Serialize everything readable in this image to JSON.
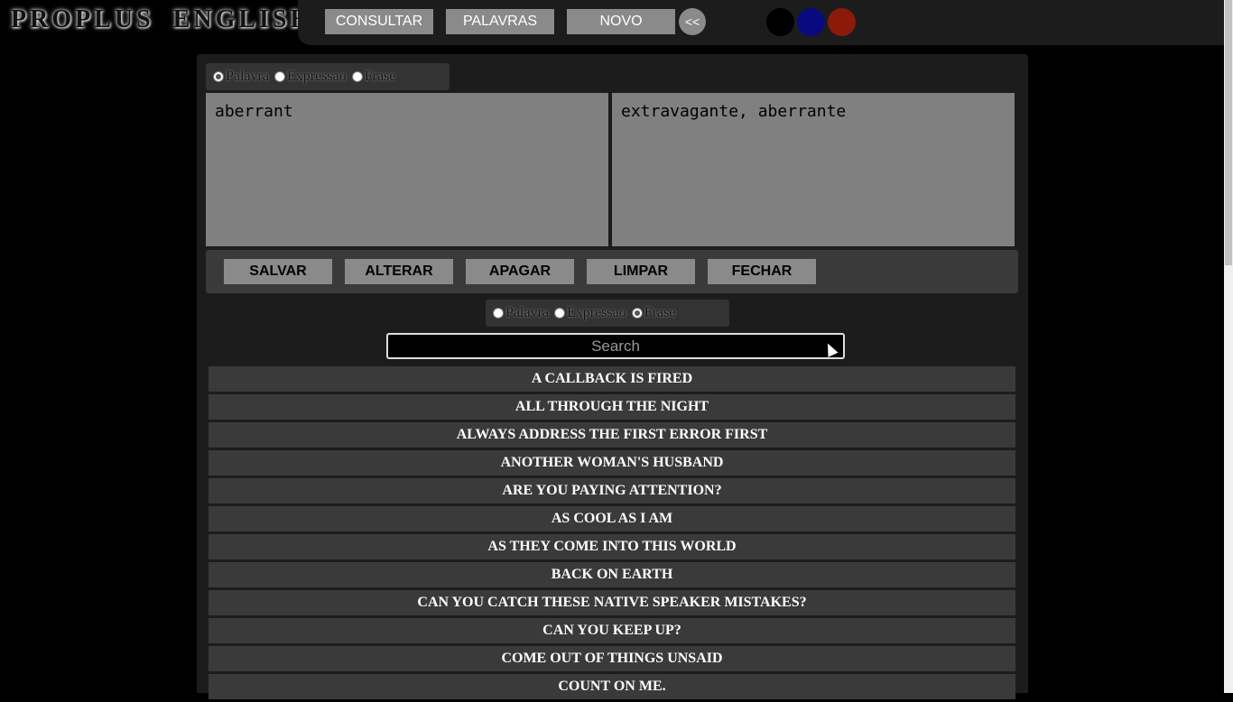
{
  "logo": "PROPLUS ENGLISH",
  "nav": {
    "consultar": "CONSULTAR",
    "palavras": "PALAVRAS",
    "novo": "NOVO",
    "collapse": "<<"
  },
  "theme_colors": [
    "#000000",
    "#0a0a80",
    "#8b1a0a"
  ],
  "entry_type": {
    "options": [
      "Palavra",
      "Expressao",
      "Frase"
    ],
    "selected": "Palavra"
  },
  "entry": {
    "term": "aberrant",
    "translation": "extravagante, aberrante"
  },
  "actions": {
    "salvar": "SALVAR",
    "alterar": "ALTERAR",
    "apagar": "APAGAR",
    "limpar": "LIMPAR",
    "fechar": "FECHAR"
  },
  "filter_type": {
    "options": [
      "Palavra",
      "Expressao",
      "Frase"
    ],
    "selected": "Frase"
  },
  "search": {
    "placeholder": "Search"
  },
  "phrases": [
    "A CALLBACK IS FIRED",
    "ALL THROUGH THE NIGHT",
    "ALWAYS ADDRESS THE FIRST ERROR FIRST",
    "ANOTHER WOMAN'S HUSBAND",
    "ARE YOU PAYING ATTENTION?",
    "AS COOL AS I AM",
    "AS THEY COME INTO THIS WORLD",
    "BACK ON EARTH",
    "CAN YOU CATCH THESE NATIVE SPEAKER MISTAKES?",
    "CAN YOU KEEP UP?",
    "COME OUT OF THINGS UNSAID",
    "COUNT ON ME."
  ]
}
